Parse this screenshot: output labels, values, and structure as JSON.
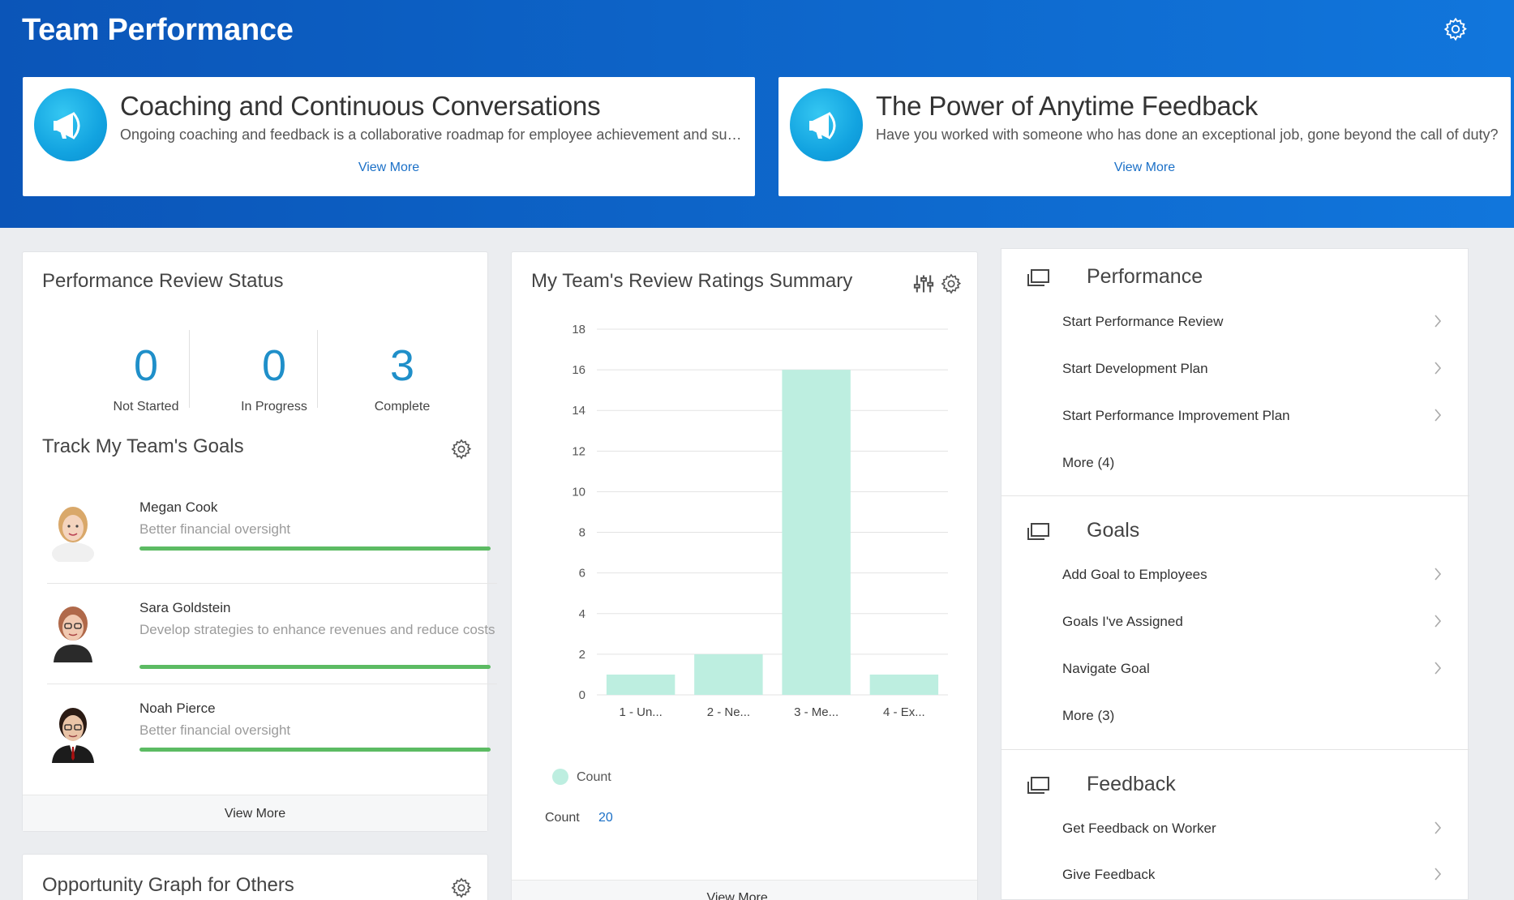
{
  "header": {
    "title": "Team Performance"
  },
  "announcements": [
    {
      "title": "Coaching and Continuous Conversations",
      "text": "Ongoing coaching and feedback is a collaborative roadmap for employee achievement and success.",
      "link": "View More"
    },
    {
      "title": "The Power of Anytime Feedback",
      "text": "Have you worked with someone who has done an exceptional job, gone beyond the call of duty?",
      "link": "View More"
    }
  ],
  "review_status": {
    "title": "Performance Review Status",
    "stats": [
      {
        "value": "0",
        "label": "Not Started"
      },
      {
        "value": "0",
        "label": "In Progress"
      },
      {
        "value": "3",
        "label": "Complete"
      }
    ]
  },
  "goals": {
    "title": "Track My Team's Goals",
    "rows": [
      {
        "name": "Megan Cook",
        "desc": "Better financial oversight"
      },
      {
        "name": "Sara Goldstein",
        "desc": "Develop strategies to enhance revenues and reduce costs"
      },
      {
        "name": "Noah Pierce",
        "desc": "Better financial oversight"
      }
    ],
    "footer": "View More"
  },
  "opportunity": {
    "title": "Opportunity Graph for Others"
  },
  "ratings": {
    "title": "My Team's Review Ratings Summary",
    "legend": "Count",
    "total_label": "Count",
    "total_value": "20",
    "footer": "View More ..."
  },
  "chart_data": {
    "type": "bar",
    "categories": [
      "1 - Un...",
      "2 - Ne...",
      "3 - Me...",
      "4 - Ex..."
    ],
    "series": [
      {
        "name": "Count",
        "values": [
          1,
          2,
          16,
          1
        ]
      }
    ],
    "ylim": [
      0,
      18
    ],
    "yticks": [
      0,
      2,
      4,
      6,
      8,
      10,
      12,
      14,
      16,
      18
    ],
    "grid": true,
    "legend_position": "bottom-left",
    "color": "#bdeee0"
  },
  "menus": [
    {
      "title": "Performance",
      "items": [
        "Start Performance Review",
        "Start Development Plan",
        "Start Performance Improvement Plan"
      ],
      "more": "More (4)"
    },
    {
      "title": "Goals",
      "items": [
        "Add Goal to Employees",
        "Goals I've Assigned",
        "Navigate Goal"
      ],
      "more": "More (3)"
    },
    {
      "title": "Feedback",
      "items": [
        "Get Feedback on Worker",
        "Give Feedback"
      ],
      "more": ""
    }
  ],
  "colors": {
    "header": "#0d64c8",
    "accent": "#1f8fc9",
    "progress": "#5cbb63",
    "link": "#1b70c7"
  }
}
